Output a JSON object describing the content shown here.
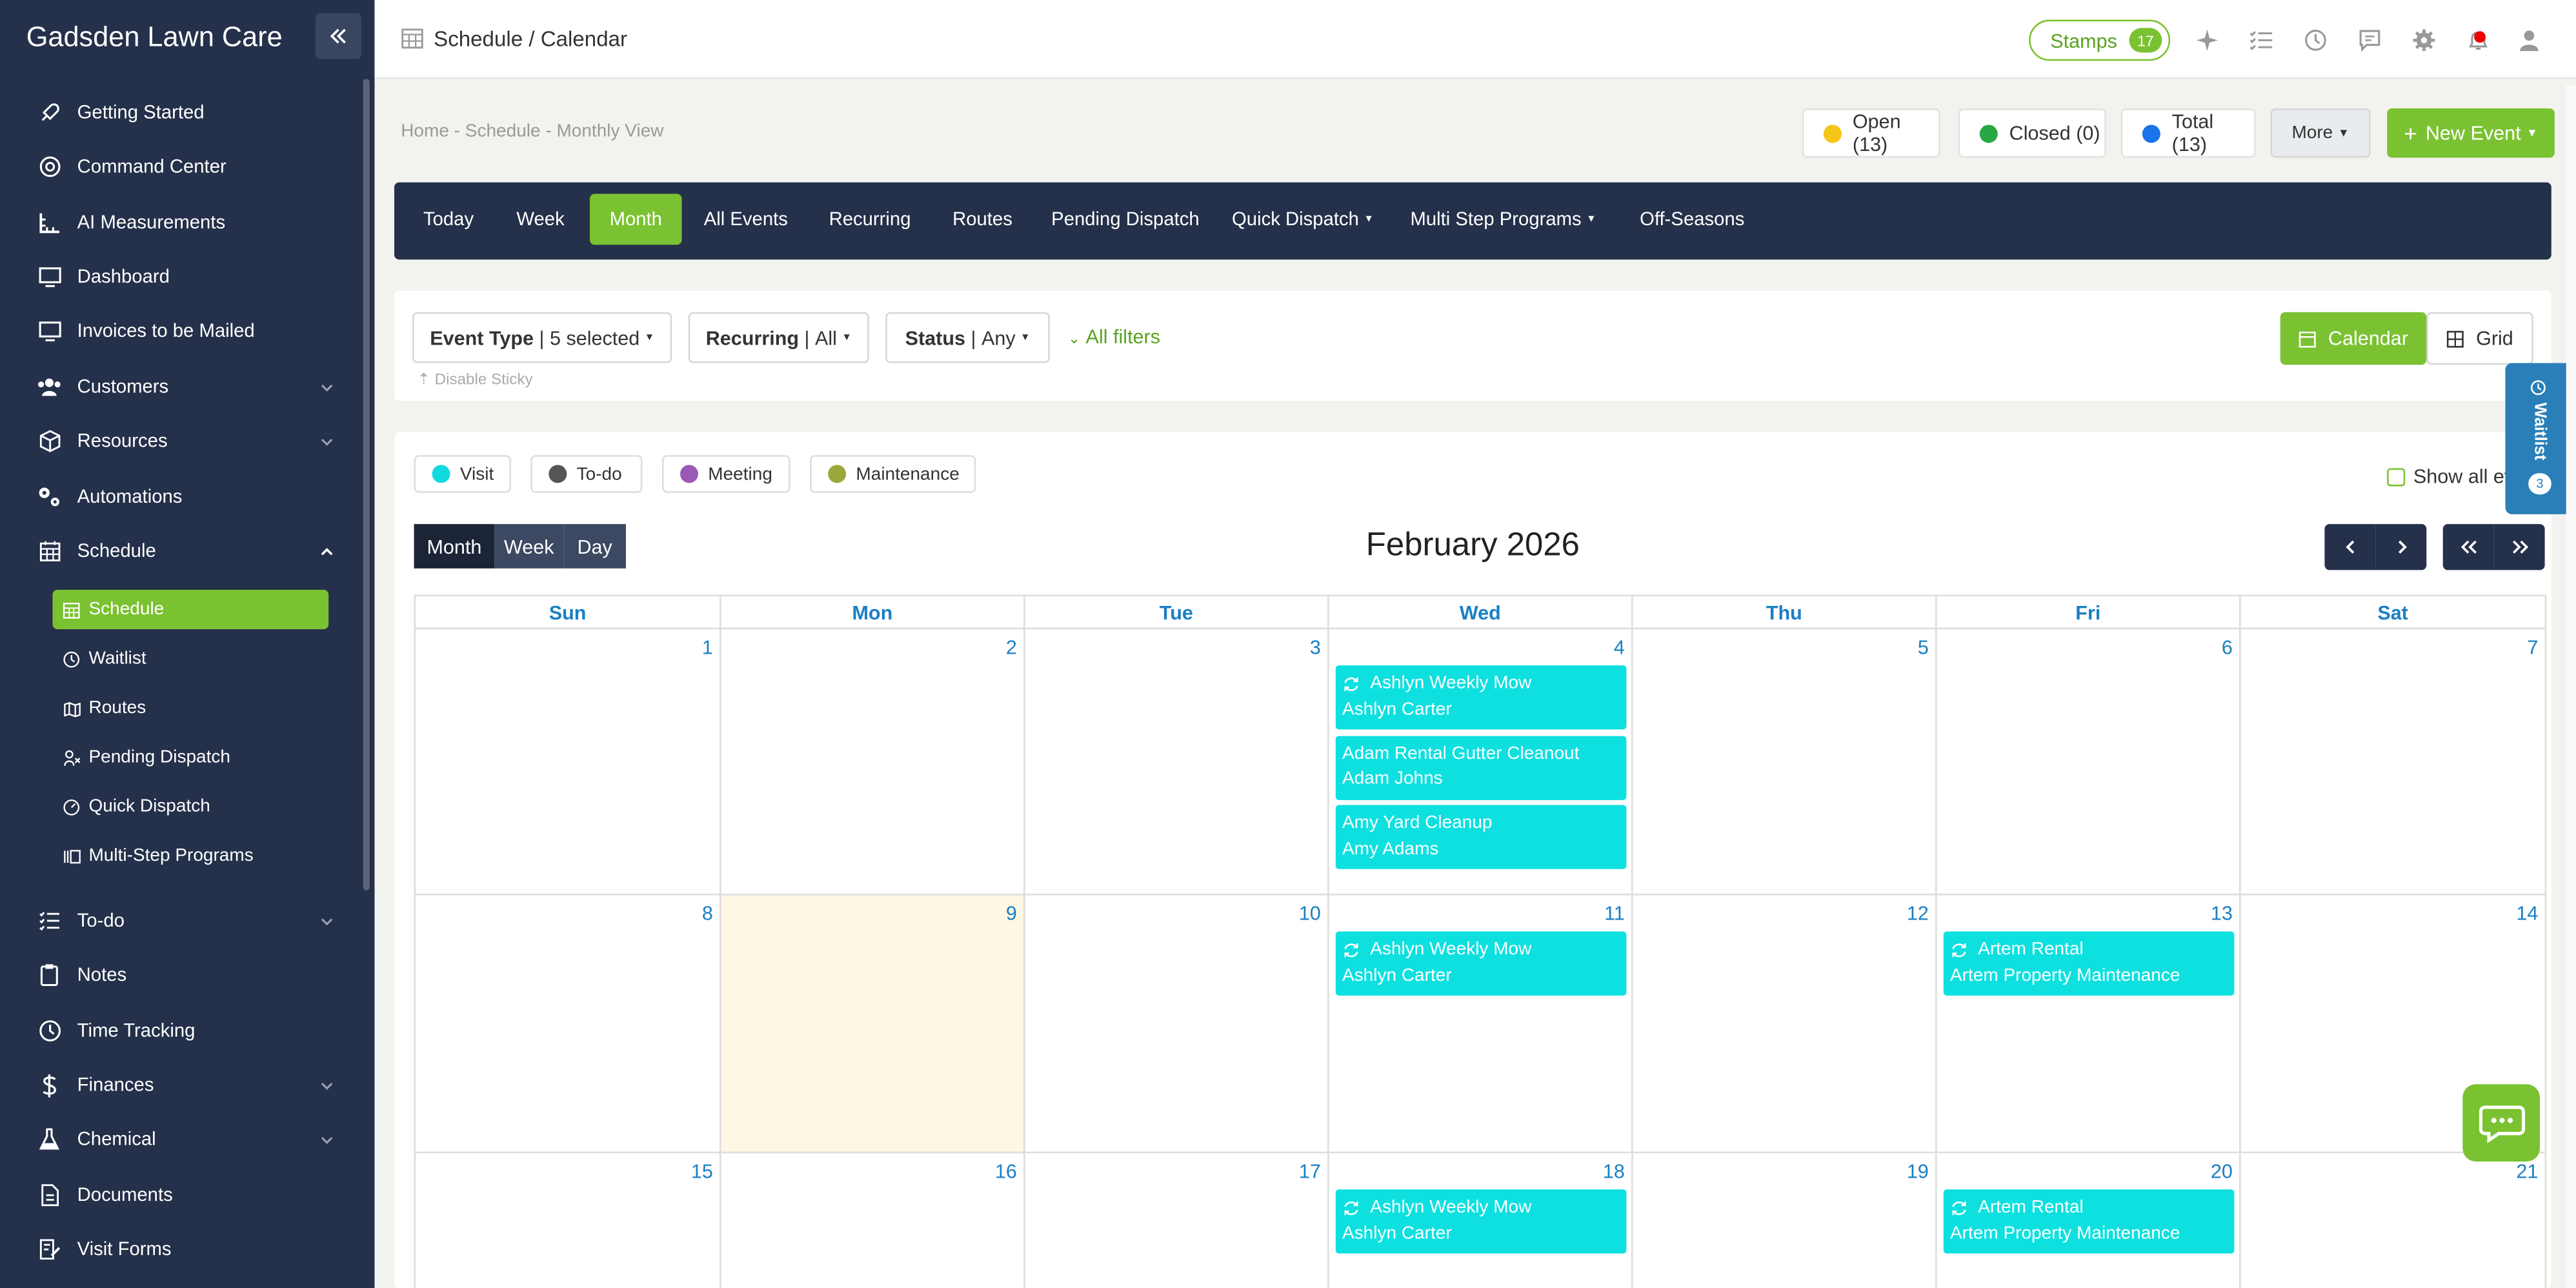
{
  "sidebar": {
    "brand": "Gadsden Lawn Care",
    "items": [
      {
        "label": "Getting Started",
        "icon": "rocket-icon"
      },
      {
        "label": "Command Center",
        "icon": "support-icon"
      },
      {
        "label": "AI Measurements",
        "icon": "ruler-icon"
      },
      {
        "label": "Dashboard",
        "icon": "monitor-icon"
      },
      {
        "label": "Invoices to be Mailed",
        "icon": "monitor-icon"
      },
      {
        "label": "Customers",
        "icon": "users-icon"
      },
      {
        "label": "Resources",
        "icon": "box-icon"
      },
      {
        "label": "Automations",
        "icon": "gears-icon"
      },
      {
        "label": "Schedule",
        "icon": "calendar-icon"
      },
      {
        "label": "To-do",
        "icon": "list-icon"
      },
      {
        "label": "Notes",
        "icon": "clipboard-icon"
      },
      {
        "label": "Time Tracking",
        "icon": "clock-icon"
      },
      {
        "label": "Finances",
        "icon": "dollar-icon"
      },
      {
        "label": "Chemical",
        "icon": "flask-icon"
      },
      {
        "label": "Documents",
        "icon": "document-icon"
      },
      {
        "label": "Visit Forms",
        "icon": "form-icon"
      }
    ],
    "schedule_sub": [
      {
        "label": "Schedule"
      },
      {
        "label": "Waitlist"
      },
      {
        "label": "Routes"
      },
      {
        "label": "Pending Dispatch"
      },
      {
        "label": "Quick Dispatch"
      },
      {
        "label": "Multi-Step Programs"
      }
    ]
  },
  "topbar": {
    "title": "Schedule / Calendar",
    "stamps_label": "Stamps",
    "stamps_count": "17"
  },
  "breadcrumb": "Home - Schedule - Monthly View",
  "status": {
    "open": "Open (13)",
    "closed": "Closed (0)",
    "total": "Total (13)",
    "open_color": "#f5c518",
    "closed_color": "#28a745",
    "total_color": "#1a73e8"
  },
  "actions": {
    "more": "More",
    "new_event": "New Event"
  },
  "tabs": [
    "Today",
    "Week",
    "Month",
    "All Events",
    "Recurring",
    "Routes",
    "Pending Dispatch",
    "Quick Dispatch",
    "Multi Step Programs",
    "Off-Seasons"
  ],
  "filters": {
    "event_type_label": "Event Type",
    "event_type_value": "5 selected",
    "recurring_label": "Recurring",
    "recurring_value": "All",
    "status_label": "Status",
    "status_value": "Any",
    "all_filters": "All filters",
    "disable_sticky": "Disable Sticky",
    "view_calendar": "Calendar",
    "view_grid": "Grid"
  },
  "legend": [
    {
      "label": "Visit",
      "color": "#12d9e0"
    },
    {
      "label": "To-do",
      "color": "#555555"
    },
    {
      "label": "Meeting",
      "color": "#9b59b6"
    },
    {
      "label": "Maintenance",
      "color": "#9aa83a"
    }
  ],
  "show_all": "Show all ev",
  "calendar": {
    "view_buttons": [
      "Month",
      "Week",
      "Day"
    ],
    "title": "February 2026",
    "days": [
      "Sun",
      "Mon",
      "Tue",
      "Wed",
      "Thu",
      "Fri",
      "Sat"
    ],
    "weeks": [
      [
        "1",
        "2",
        "3",
        "4",
        "5",
        "6",
        "7"
      ],
      [
        "8",
        "9",
        "10",
        "11",
        "12",
        "13",
        "14"
      ],
      [
        "15",
        "16",
        "17",
        "18",
        "19",
        "20",
        "21"
      ]
    ],
    "events": {
      "w0d3": [
        {
          "title": "Ashlyn Weekly Mow",
          "sub": "Ashlyn Carter",
          "recurring": true
        },
        {
          "title": "Adam Rental Gutter Cleanout",
          "sub": "Adam Johns",
          "recurring": false
        },
        {
          "title": "Amy Yard Cleanup",
          "sub": "Amy Adams",
          "recurring": false
        }
      ],
      "w1d3": [
        {
          "title": "Ashlyn Weekly Mow",
          "sub": "Ashlyn Carter",
          "recurring": true
        }
      ],
      "w1d5": [
        {
          "title": "Artem Rental",
          "sub": "Artem Property Maintenance",
          "recurring": true
        }
      ],
      "w2d3": [
        {
          "title": "Ashlyn Weekly Mow",
          "sub": "Ashlyn Carter",
          "recurring": true
        }
      ],
      "w2d5": [
        {
          "title": "Artem Rental",
          "sub": "Artem Property Maintenance",
          "recurring": true
        }
      ]
    }
  },
  "waitlist": {
    "label": "Waitlist",
    "count": "3"
  }
}
